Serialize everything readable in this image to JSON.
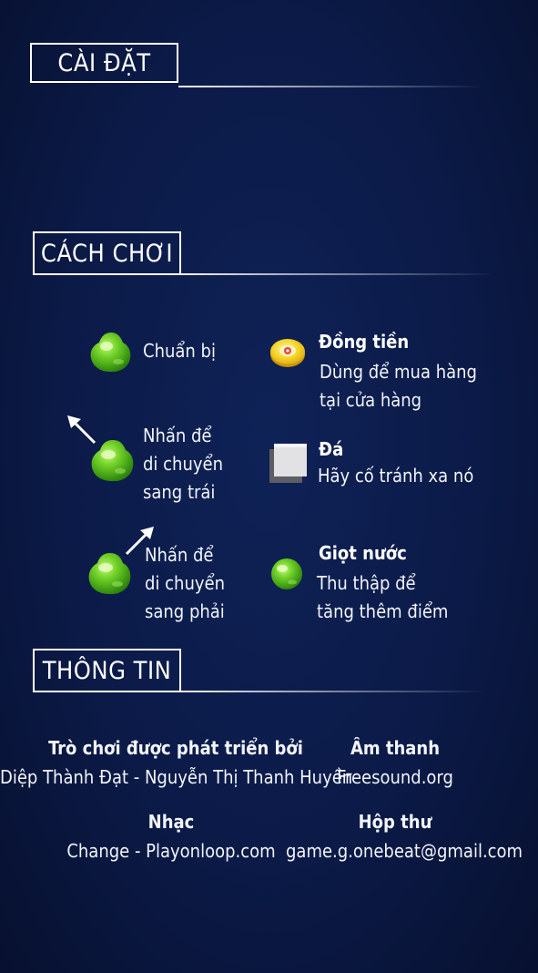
{
  "sections": {
    "settings": "CÀI ĐẶT",
    "howto": "CÁCH CHƠI",
    "info": "THÔNG TIN"
  },
  "howto": {
    "ready": {
      "label": "Chuẩn bị"
    },
    "tap_left": {
      "line1": "Nhấn để",
      "line2": "di chuyển",
      "line3": "sang trái"
    },
    "tap_right": {
      "line1": "Nhấn để",
      "line2": "di chuyển",
      "line3": "sang phải"
    },
    "coin": {
      "title": "Đồng tiền",
      "line1": "Dùng để mua hàng",
      "line2": "tại cửa hàng"
    },
    "stone": {
      "title": "Đá",
      "line1": "Hãy cố tránh xa nó"
    },
    "drop": {
      "title": "Giọt nước",
      "line1": "Thu thập để",
      "line2": "tăng thêm điểm"
    }
  },
  "credits": {
    "developer": {
      "title": "Trò chơi được phát triển bởi",
      "value": "Diệp Thành Đạt - Nguyễn Thị Thanh Huyền"
    },
    "sound": {
      "title": "Âm thanh",
      "value": "Freesound.org"
    },
    "music": {
      "title": "Nhạc",
      "value": "Change - Playonloop.com"
    },
    "mailbox": {
      "title": "Hộp thư",
      "value": "game.g.onebeat@gmail.com"
    }
  },
  "icons": {
    "ready": "green-blob-icon",
    "left": "green-blob-up-left-arrow-icon",
    "right": "green-blob-up-right-arrow-icon",
    "coin": "coin-icon",
    "stone": "stone-block-icon",
    "drop": "water-drop-icon"
  },
  "colors": {
    "background": "#0b1a47",
    "blob": "#5cc423",
    "coin": "#f7d42a"
  }
}
